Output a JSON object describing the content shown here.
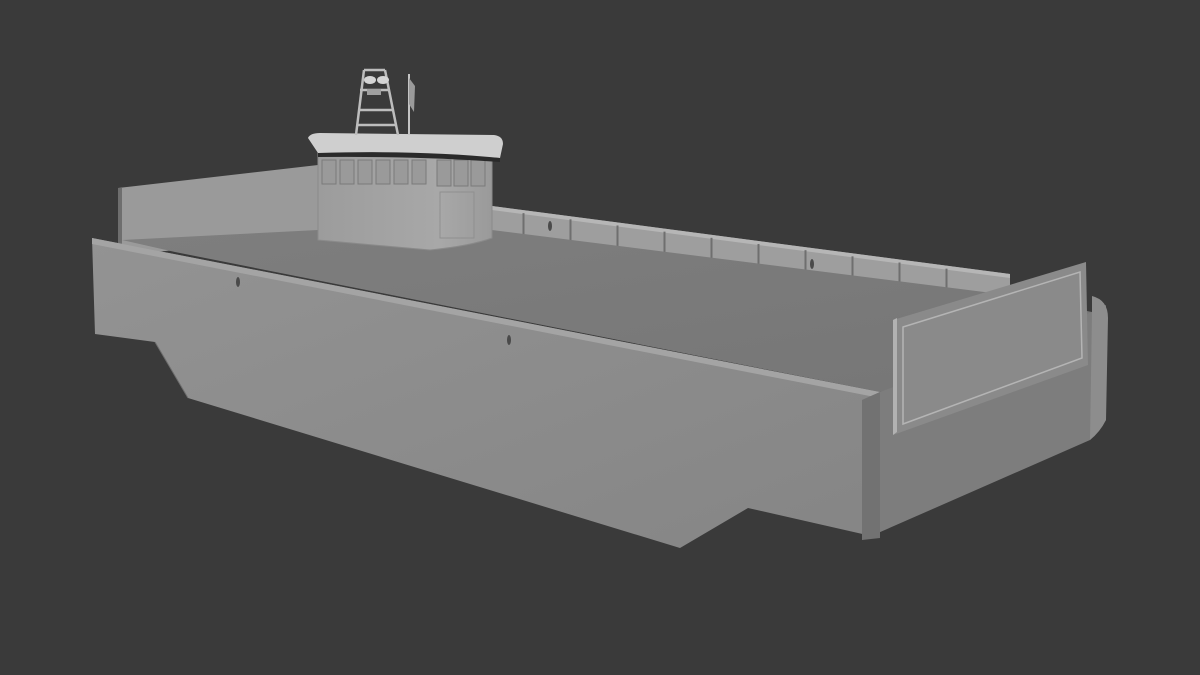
{
  "scene": {
    "subject": "3d-barge-model",
    "background_color": "#3a3a3a",
    "shading_colors": {
      "hull_side": "#8a8a8a",
      "hull_front": "#777777",
      "deck": "#7c7c7c",
      "bulwark_inner": "#9a9a9a",
      "wheelhouse": "#a2a2a2",
      "roof": "#c9c9c9"
    },
    "window_count_front": 6,
    "window_count_side": 3,
    "stanchion_count": 10,
    "porthole_count": 5
  }
}
